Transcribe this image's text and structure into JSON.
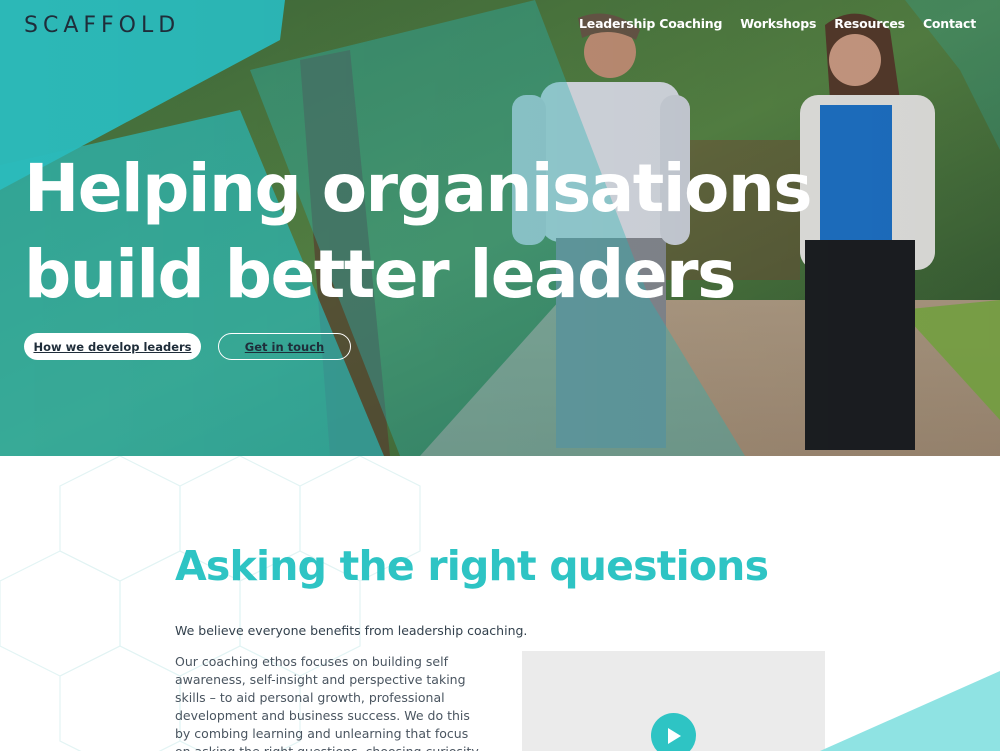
{
  "brand": {
    "logo_text": "SCAFFOLD"
  },
  "nav": {
    "items": [
      "Leadership Coaching",
      "Workshops",
      "Resources",
      "Contact"
    ]
  },
  "hero": {
    "title_line1": "Helping organisations",
    "title_line2": "build better leaders",
    "primary_button": "How we develop leaders",
    "secondary_button": "Get in touch"
  },
  "intro": {
    "heading": "Asking the right questions",
    "lead": "We believe everyone benefits from leadership coaching.",
    "body": "Our coaching ethos focuses on building self awareness, self-insight and perspective taking skills – to aid personal growth, professional development and business success. We do this by combing learning and unlearning that focus on asking the right questions, choosing curiosity over certainly and testing assumptions."
  },
  "colors": {
    "accent": "#2ec4c4",
    "dark_text": "#1f2d3a",
    "video_bg": "#ebebeb"
  },
  "icons": {
    "play": "play-icon"
  }
}
